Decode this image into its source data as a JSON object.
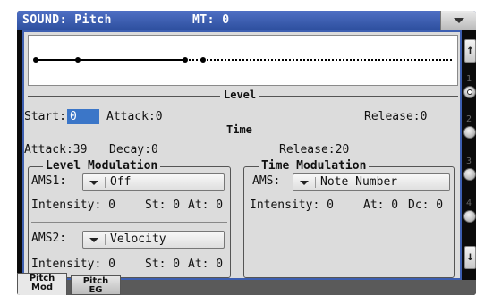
{
  "header": {
    "title": "SOUND: Pitch",
    "mt_label": "MT: 0"
  },
  "level_section": {
    "title": "Level",
    "start_label": "Start:",
    "start_value": "0",
    "attack": "Attack:0",
    "release": "Release:0"
  },
  "time_section": {
    "title": "Time",
    "attack": "Attack:39",
    "decay": "Decay:0",
    "release": "Release:20"
  },
  "level_modulation": {
    "title": "Level Modulation",
    "ams1_label": "AMS1:",
    "ams1_value": "Off",
    "row1_intensity": "Intensity: 0",
    "row1_st": "St: 0",
    "row1_at": "At: 0",
    "ams2_label": "AMS2:",
    "ams2_value": "Velocity",
    "row2_intensity": "Intensity: 0",
    "row2_st": "St: 0",
    "row2_at": "At: 0"
  },
  "time_modulation": {
    "title": "Time Modulation",
    "ams_label": "AMS:",
    "ams_value": "Note Number",
    "intensity": "Intensity: 0",
    "at": "At: 0",
    "dc": "Dc: 0"
  },
  "sidebar": {
    "pages": [
      "1",
      "2",
      "3",
      "4"
    ],
    "active_page": "1",
    "up_icon": "arrow-up-icon",
    "down_icon": "arrow-down-icon"
  },
  "tabs": [
    {
      "line1": "Pitch",
      "line2": "Mod",
      "active": true
    },
    {
      "line1": "Pitch",
      "line2": "EG",
      "active": false
    }
  ],
  "colors": {
    "title_bar": "#3b5db4",
    "panel": "#dcdcdc",
    "selected_field": "#3b76c8"
  }
}
